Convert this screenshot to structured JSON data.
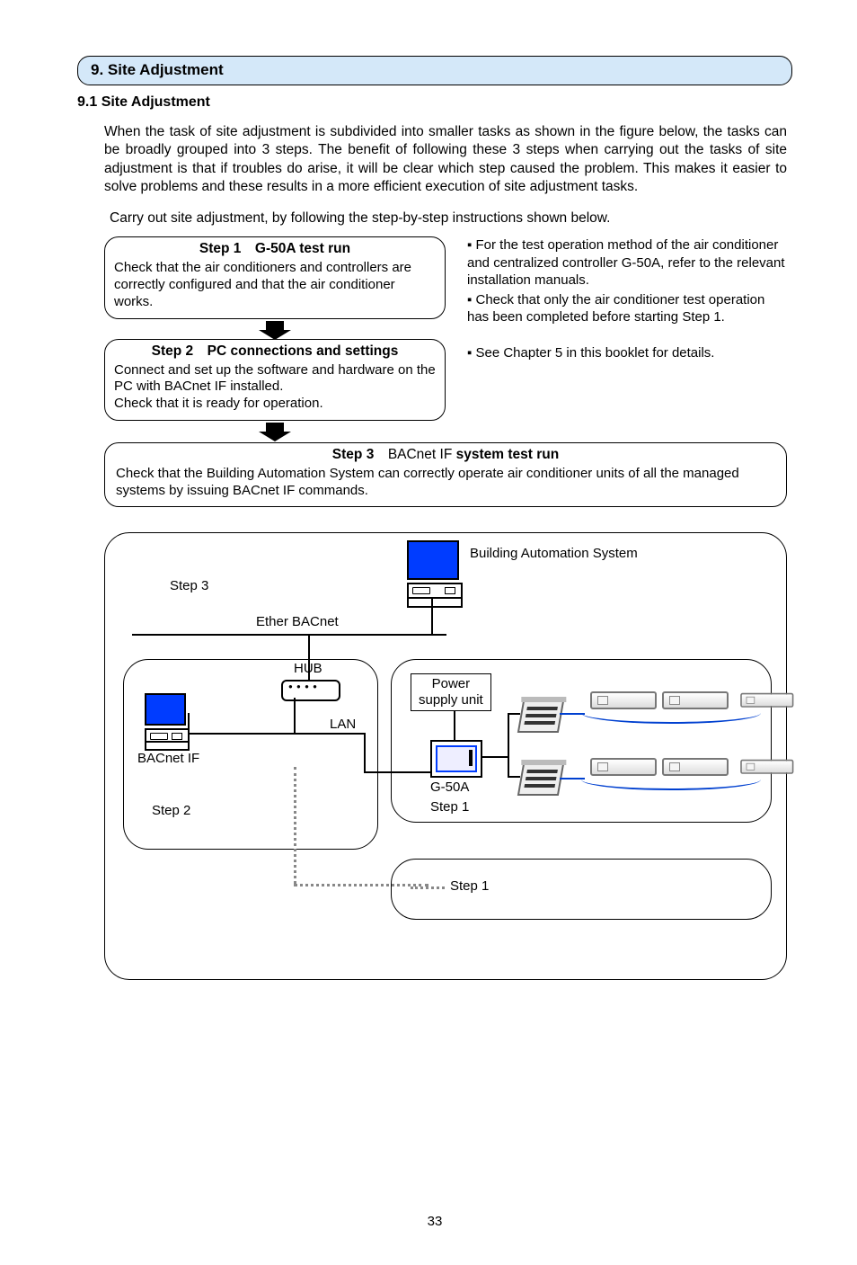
{
  "section_bar": "9. Site Adjustment",
  "subheading": "9.1 Site Adjustment",
  "intro_para": "When the task of site adjustment is subdivided into smaller tasks as shown in the figure below, the tasks can be broadly grouped into 3 steps. The benefit of following these 3 steps when carrying out the tasks of site adjustment is that if troubles do arise, it will be clear which step caused the problem. This makes it easier to solve problems and these results in a more efficient execution of site adjustment tasks.",
  "carry_out": "Carry out site adjustment, by following the step-by-step instructions shown below.",
  "step1": {
    "title_prefix": "Step 1 ",
    "title_bold": "G-50A test run",
    "body": "Check that the air conditioners and controllers are correctly configured and that the air conditioner works."
  },
  "step2": {
    "title_prefix": "Step 2 ",
    "title_bold": "PC connections and settings",
    "body": "Connect and set up the software and hardware on the PC with BACnet IF installed.\nCheck that it is ready for operation."
  },
  "step3": {
    "title_prefix": "Step 3 ",
    "title_mid": "BACnet IF ",
    "title_bold": "system test run",
    "body": "Check that the Building Automation System can correctly operate air conditioner units of all the managed systems by issuing BACnet IF commands."
  },
  "right_notes_1a": "▪ For the test operation method of the air conditioner and centralized controller G-50A, refer to the relevant installation manuals.",
  "right_notes_1b": "▪ Check that only the air conditioner test operation has been completed before starting Step 1.",
  "right_notes_2": "▪ See Chapter 5 in this booklet for details.",
  "diagram": {
    "bas": "Building Automation System",
    "step3": "Step 3",
    "ether": "Ether BACnet",
    "hub": "HUB",
    "lan": "LAN",
    "bacnet_if": "BACnet IF",
    "step2": "Step 2",
    "psu": "Power\nsupply unit",
    "g50a": "G-50A",
    "step1a": "Step 1",
    "step1b": "Step 1"
  },
  "page_number": "33"
}
